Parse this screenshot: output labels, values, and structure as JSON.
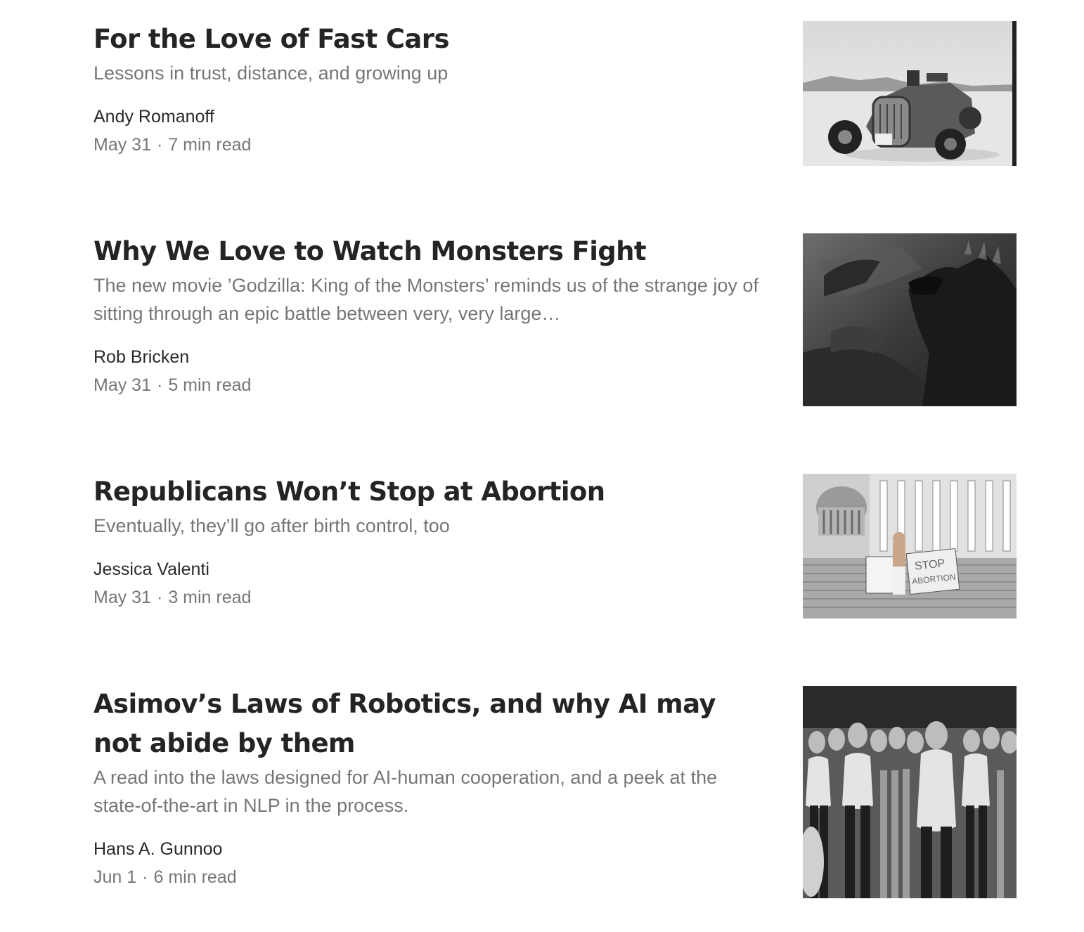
{
  "stories": [
    {
      "title": "For the Love of Fast Cars",
      "subtitle": "Lessons in trust, distance, and growing up",
      "author": "Andy Romanoff",
      "date": "May 31",
      "separator": "·",
      "read_time": "7 min read",
      "image": "vintage-hot-rod-salt-flats"
    },
    {
      "title": "Why We Love to Watch Monsters Fight",
      "subtitle": "The new movie ’Godzilla: King of the Monsters’ reminds us of the strange joy of sitting through an epic battle between very, very large…",
      "author": "Rob Bricken",
      "date": "May 31",
      "separator": "·",
      "read_time": "5 min read",
      "image": "godzilla-monster-battle"
    },
    {
      "title": "Republicans Won’t Stop at Abortion",
      "subtitle": "Eventually, they’ll go after birth control, too",
      "author": "Jessica Valenti",
      "date": "May 31",
      "separator": "·",
      "read_time": "3 min read",
      "image": "capitol-protester-signs",
      "image_sign_text": [
        "STOP",
        "ABORTION"
      ]
    },
    {
      "title": "Asimov’s Laws of Robotics, and why AI may not abide by them",
      "subtitle": "A read into the laws designed for AI-human cooperation, and a peek at the state-of-the-art in NLP in the process.",
      "author": "Hans A. Gunnoo",
      "date": "Jun 1",
      "separator": "·",
      "read_time": "6 min read",
      "image": "robot-army-crowd"
    }
  ]
}
